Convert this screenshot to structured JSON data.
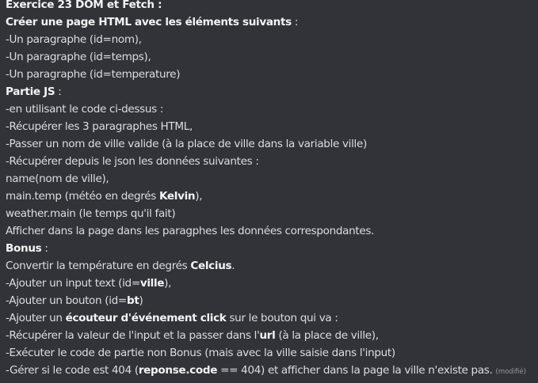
{
  "message": {
    "title": "Exercice 23 DOM et Fetch",
    "title_suffix": " :",
    "intro_bold": "Créer une page HTML avec les éléments suivants",
    "intro_suffix": " :",
    "item1": "-Un paragraphe (id=nom),",
    "item2": "-Un paragraphe (id=temps),",
    "item3": "-Un paragraphe (id=temperature)",
    "part_js": "Partie JS",
    "part_js_suffix": " :",
    "js1": "-en utilisant le code ci-dessus :",
    "js2": "-Récupérer les 3 paragraphes HTML,",
    "js3": "-Passer un nom de ville valide  (à la place de ville dans la variable ville)",
    "js4": "-Récupérer depuis le json les données suivantes :",
    "js5": "name(nom de ville),",
    "js6_pre": "main.temp (météo en degrés ",
    "js6_bold": "Kelvin",
    "js6_post": "),",
    "js7": "weather.main (le temps qu'il fait)",
    "js8": "Afficher dans la page dans les paragphes les données correspondantes.",
    "bonus": "Bonus",
    "bonus_suffix": " :",
    "b1_pre": "Convertir la température en degrés ",
    "b1_bold": "Celcius",
    "b1_post": ".",
    "b2_pre": "-Ajouter un input text (id=",
    "b2_bold": "ville",
    "b2_post": "),",
    "b3_pre": "-Ajouter un bouton (id=",
    "b3_bold": "bt",
    "b3_post": ")",
    "b4_pre": "-Ajouter un ",
    "b4_bold": "écouteur d'événement click",
    "b4_post": "  sur le bouton qui va :",
    "b5_pre": "-Récupérer la valeur de l'input et la passer dans l'",
    "b5_bold": "url",
    "b5_post": " (à la place de ville),",
    "b6": "-Exécuter le code de partie non Bonus (mais avec la ville saisie dans l'input)",
    "b7_pre": "-Gérer si le code est 404 (",
    "b7_bold": "reponse.code",
    "b7_post": " == 404) et afficher dans la page la ville n'existe pas.",
    "edited": "(modifié)"
  }
}
